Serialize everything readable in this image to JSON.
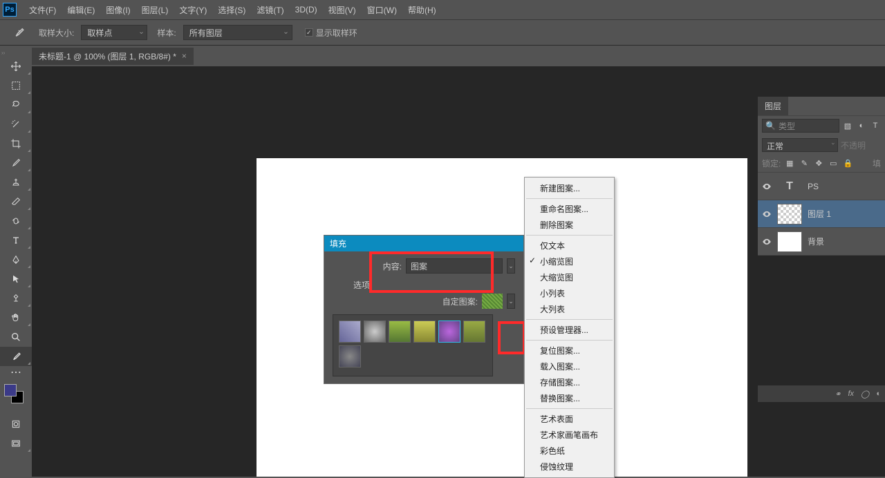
{
  "menubar": [
    "文件(F)",
    "编辑(E)",
    "图像(I)",
    "图层(L)",
    "文字(Y)",
    "选择(S)",
    "滤镜(T)",
    "3D(D)",
    "视图(V)",
    "窗口(W)",
    "帮助(H)"
  ],
  "optbar": {
    "sample_size_label": "取样大小:",
    "sample_size_value": "取样点",
    "sample_label": "样本:",
    "sample_value": "所有图层",
    "show_ring": "显示取样环"
  },
  "doc_tab": "未标题-1 @ 100% (图层 1, RGB/8#) *",
  "fill_dialog": {
    "title": "填充",
    "content_label": "内容:",
    "content_value": "图案",
    "options_label": "选项",
    "custom_pattern_label": "自定图案:"
  },
  "ctx_menu": [
    {
      "t": "新建图案..."
    },
    {
      "sep": true
    },
    {
      "t": "重命名图案..."
    },
    {
      "t": "删除图案"
    },
    {
      "sep": true
    },
    {
      "t": "仅文本"
    },
    {
      "t": "小缩览图",
      "checked": true
    },
    {
      "t": "大缩览图"
    },
    {
      "t": "小列表"
    },
    {
      "t": "大列表"
    },
    {
      "sep": true
    },
    {
      "t": "预设管理器..."
    },
    {
      "sep": true
    },
    {
      "t": "复位图案..."
    },
    {
      "t": "载入图案..."
    },
    {
      "t": "存储图案..."
    },
    {
      "t": "替换图案..."
    },
    {
      "sep": true
    },
    {
      "t": "艺术表面"
    },
    {
      "t": "艺术家画笔画布"
    },
    {
      "t": "彩色纸"
    },
    {
      "t": "侵蚀纹理"
    }
  ],
  "layers_panel": {
    "tab": "图层",
    "filter_placeholder": "类型",
    "mode": "正常",
    "opacity_label": "不透明",
    "lock_label": "锁定:",
    "fill_label": "填",
    "layers": [
      {
        "name": "PS",
        "type": "text"
      },
      {
        "name": "图层 1",
        "type": "raster",
        "selected": true
      },
      {
        "name": "背景",
        "type": "bg"
      }
    ],
    "footer_fx": "fx"
  }
}
